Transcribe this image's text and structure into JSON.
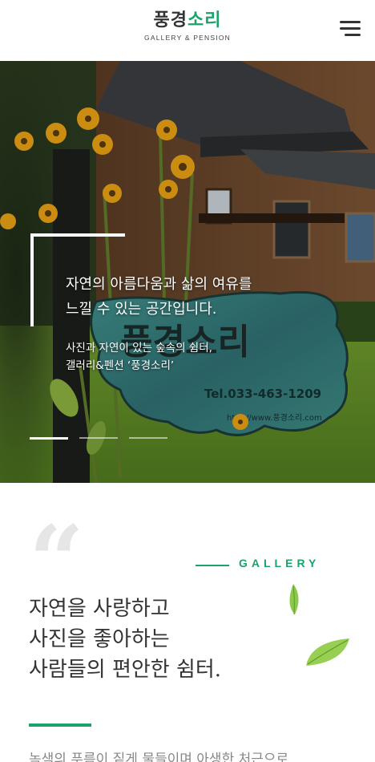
{
  "header": {
    "logo_part1": "풍경",
    "logo_part2": "소리",
    "logo_sub": "GALLERY & PENSION",
    "menu_icon": "hamburger-menu-icon"
  },
  "hero": {
    "title_line1": "자연의 아름다움과 삶의 여유를",
    "title_line2": "느낄 수 있는 공간입니다.",
    "sub_line1": "사진과 자연이 있는 숲속의 쉼터,",
    "sub_line2": "갤러리&펜션 ‘풍경소리’",
    "sign_text": "풍경소리",
    "sign_tel": "Tel.033-463-1209",
    "sign_url": "http://www.풍경소리.com",
    "slides_count": 3,
    "active_slide": 1
  },
  "gallery": {
    "label": "GALLERY",
    "heading_line1": "자연을 사랑하고",
    "heading_line2": "사진을 좋아하는",
    "heading_line3": "사람들의 편안한 쉼터.",
    "intro_text": "녹색의 푸름이 짙게 물들이며 아생한 처근으로",
    "quote_mark": "“"
  },
  "colors": {
    "accent": "#1aa36a",
    "text": "#333333",
    "muted": "#888888"
  }
}
